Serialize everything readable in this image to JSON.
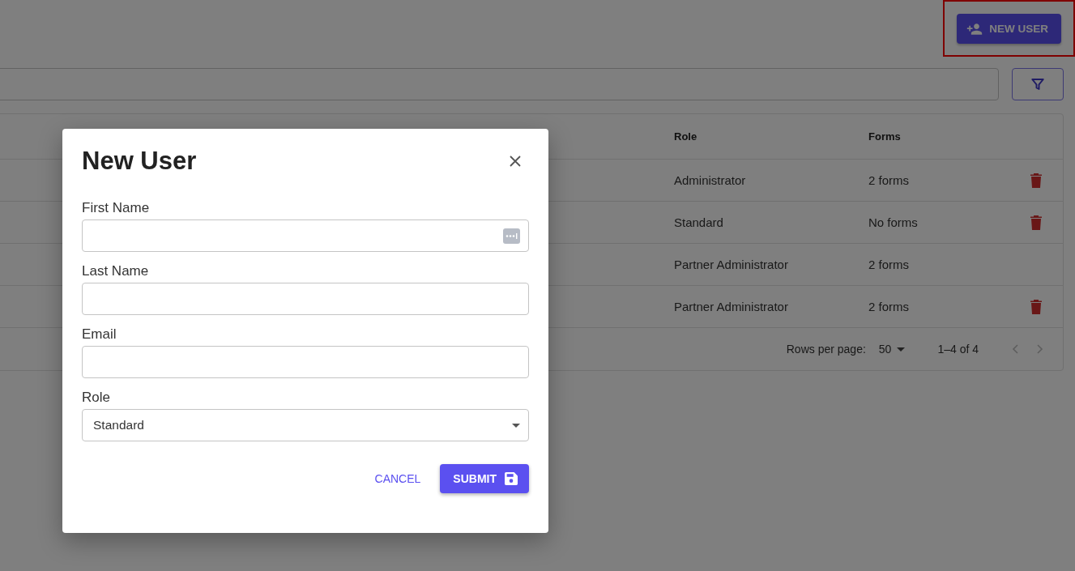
{
  "header": {
    "new_user_button": {
      "label": "NEW USER",
      "highlighted": true
    }
  },
  "table": {
    "columns": [
      "Role",
      "Forms"
    ],
    "rows": [
      {
        "role": "Administrator",
        "forms": "2 forms",
        "deletable": true
      },
      {
        "role": "Standard",
        "forms": "No forms",
        "deletable": true
      },
      {
        "role": "Partner Administrator",
        "forms": "2 forms",
        "deletable": false
      },
      {
        "role": "Partner Administrator",
        "forms": "2 forms",
        "deletable": true
      }
    ],
    "pagination": {
      "rows_per_page_label": "Rows per page:",
      "rows_per_page": "50",
      "range": "1–4 of 4",
      "prev_disabled": true,
      "next_disabled": true
    }
  },
  "dialog": {
    "title": "New User",
    "fields": [
      {
        "kind": "text",
        "label": "First Name",
        "autofill_icon": true
      },
      {
        "kind": "text",
        "label": "Last Name",
        "autofill_icon": false
      },
      {
        "kind": "text",
        "label": "Email",
        "autofill_icon": false
      },
      {
        "kind": "select",
        "label": "Role",
        "value": "Standard",
        "autofill_icon": false
      }
    ],
    "cancel": "CANCEL",
    "submit": "SUBMIT"
  }
}
